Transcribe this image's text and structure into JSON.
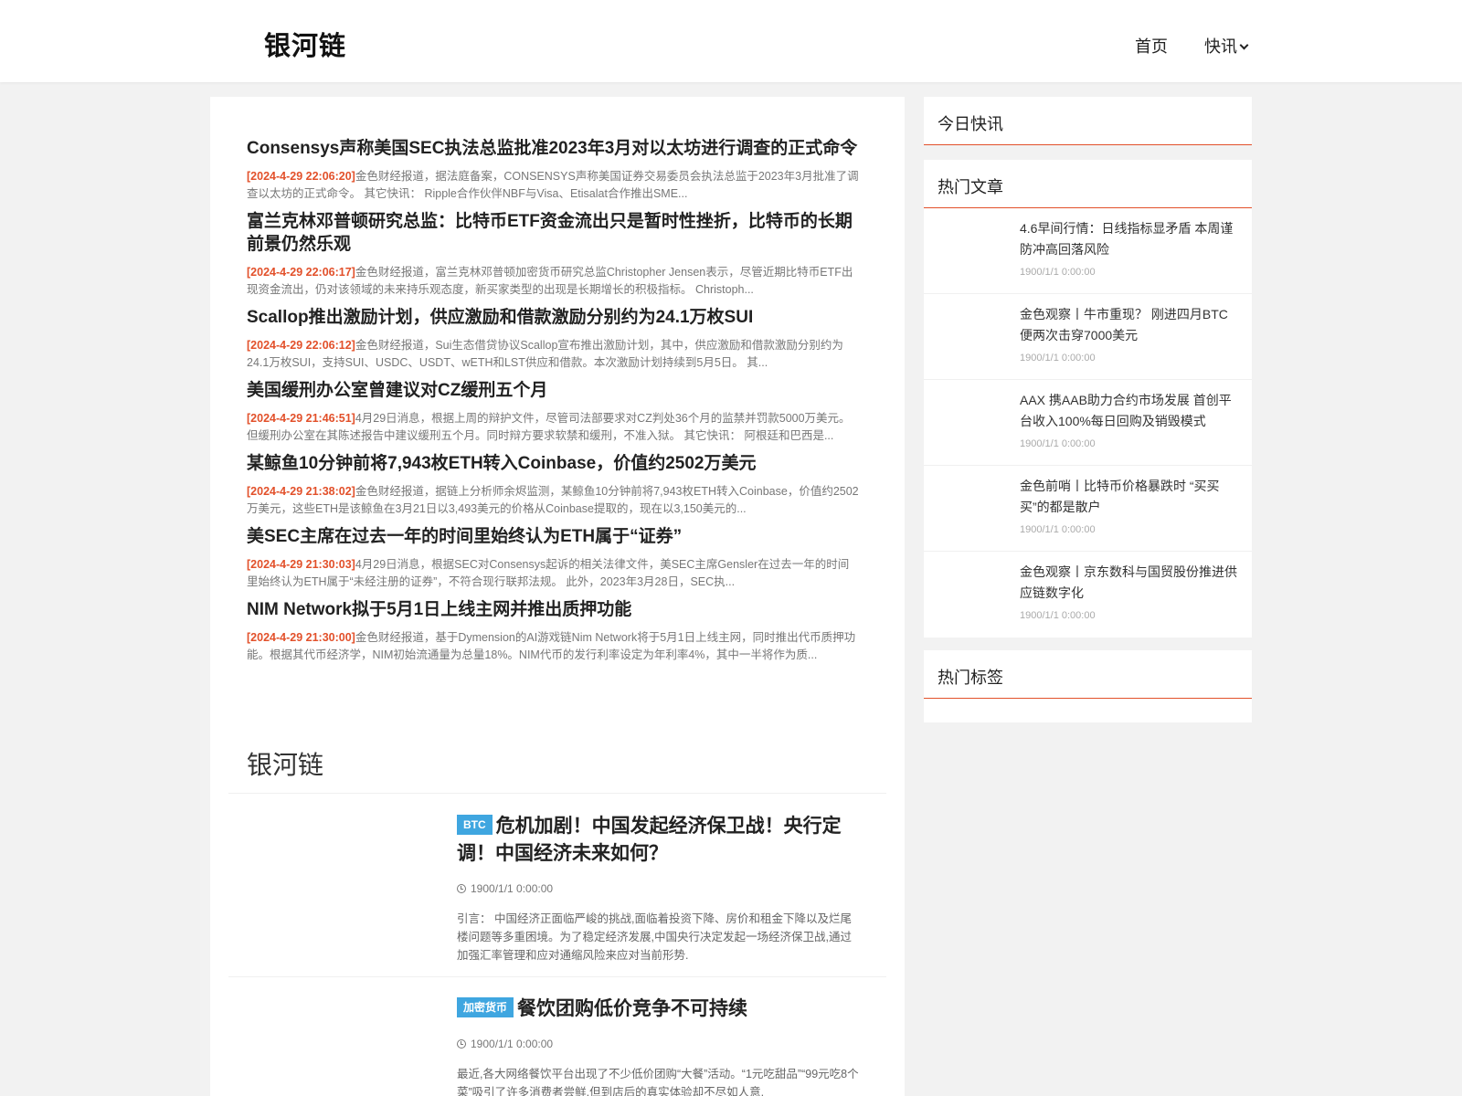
{
  "header": {
    "logo": "银河链",
    "nav": {
      "home": "首页",
      "flash": "快讯"
    }
  },
  "flash_news": [
    {
      "title": "Consensys声称美国SEC执法总监批准2023年3月对以太坊进行调查的正式命令",
      "time": "[2024-4-29 22:06:20]",
      "desc": "金色财经报道，据法庭备案，CONSENSYS声称美国证券交易委员会执法总监于2023年3月批准了调查以太坊的正式命令。 其它快讯： Ripple合作伙伴NBF与Visa、Etisalat合作推出SME..."
    },
    {
      "title": "富兰克林邓普顿研究总监：比特币ETF资金流出只是暂时性挫折，比特币的长期前景仍然乐观",
      "time": "[2024-4-29 22:06:17]",
      "desc": "金色财经报道，富兰克林邓普顿加密货币研究总监Christopher Jensen表示，尽管近期比特币ETF出现资金流出，仍对该领域的未来持乐观态度，新买家类型的出现是长期增长的积极指标。 Christoph..."
    },
    {
      "title": "Scallop推出激励计划，供应激励和借款激励分别约为24.1万枚SUI",
      "time": "[2024-4-29 22:06:12]",
      "desc": "金色财经报道，Sui生态借贷协议Scallop宣布推出激励计划，其中，供应激励和借款激励分别约为24.1万枚SUI，支持SUI、USDC、USDT、wETH和LST供应和借款。本次激励计划持续到5月5日。 其..."
    },
    {
      "title": "美国缓刑办公室曾建议对CZ缓刑五个月",
      "time": "[2024-4-29 21:46:51]",
      "desc": "4月29日消息，根据上周的辩护文件，尽管司法部要求对CZ判处36个月的监禁并罚款5000万美元。但缓刑办公室在其陈述报告中建议缓刑五个月。同时辩方要求软禁和缓刑，不准入狱。 其它快讯： 阿根廷和巴西是..."
    },
    {
      "title": "某鲸鱼10分钟前将7,943枚ETH转入Coinbase，价值约2502万美元",
      "time": "[2024-4-29 21:38:02]",
      "desc": "金色财经报道，据链上分析师余烬监测，某鲸鱼10分钟前将7,943枚ETH转入Coinbase，价值约2502万美元，这些ETH是该鲸鱼在3月21日以3,493美元的价格从Coinbase提取的，现在以3,150美元的..."
    },
    {
      "title": "美SEC主席在过去一年的时间里始终认为ETH属于“证券”",
      "time": "[2024-4-29 21:30:03]",
      "desc": "4月29日消息，根据SEC对Consensys起诉的相关法律文件，美SEC主席Gensler在过去一年的时间里始终认为ETH属于“未经注册的证券”，不符合现行联邦法规。 此外，2023年3月28日，SEC执..."
    },
    {
      "title": "NIM Network拟于5月1日上线主网并推出质押功能",
      "time": "[2024-4-29 21:30:00]",
      "desc": "金色财经报道，基于Dymension的AI游戏链Nim Network将于5月1日上线主网，同时推出代币质押功能。根据其代币经济学，NIM初始流通量为总量18%。NIM代币的发行利率设定为年利率4%，其中一半将作为质..."
    }
  ],
  "section": {
    "title": "银河链"
  },
  "articles": [
    {
      "tag": "BTC",
      "title": "危机加剧！中国发起经济保卫战！央行定调！中国经济未来如何？",
      "date": "1900/1/1 0:00:00",
      "excerpt": "引言： 中国经济正面临严峻的挑战,面临着投资下降、房价和租金下降以及烂尾楼问题等多重困境。为了稳定经济发展,中国央行决定发起一场经济保卫战,通过加强汇率管理和应对通缩风险来应对当前形势."
    },
    {
      "tag": "加密货币",
      "title": "餐饮团购低价竞争不可持续",
      "date": "1900/1/1 0:00:00",
      "excerpt": "最近,各大网络餐饮平台出现了不少低价团购“大餐”活动。“1元吃甜品”“99元吃8个菜”吸引了许多消费者尝鲜,但到店后的真实体验却不尽如人意."
    }
  ],
  "sidebar": {
    "today_flash": {
      "title": "今日快讯"
    },
    "hot_articles": {
      "title": "热门文章",
      "items": [
        {
          "title": "4.6早间行情：日线指标显矛盾 本周谨防冲高回落风险",
          "date": "1900/1/1 0:00:00"
        },
        {
          "title": "金色观察丨牛市重现？ 刚进四月BTC便两次击穿7000美元",
          "date": "1900/1/1 0:00:00"
        },
        {
          "title": "AAX 携AAB助力合约市场发展 首创平台收入100%每日回购及销毁模式",
          "date": "1900/1/1 0:00:00"
        },
        {
          "title": "金色前哨丨比特币价格暴跌时 “买买买”的都是散户",
          "date": "1900/1/1 0:00:00"
        },
        {
          "title": "金色观察丨京东数科与国贸股份推进供应链数字化",
          "date": "1900/1/1 0:00:00"
        }
      ]
    },
    "hot_tags": {
      "title": "热门标签"
    }
  },
  "colors": {
    "accent_red": "#e2502a",
    "tag_blue": "#3fa6e0"
  }
}
